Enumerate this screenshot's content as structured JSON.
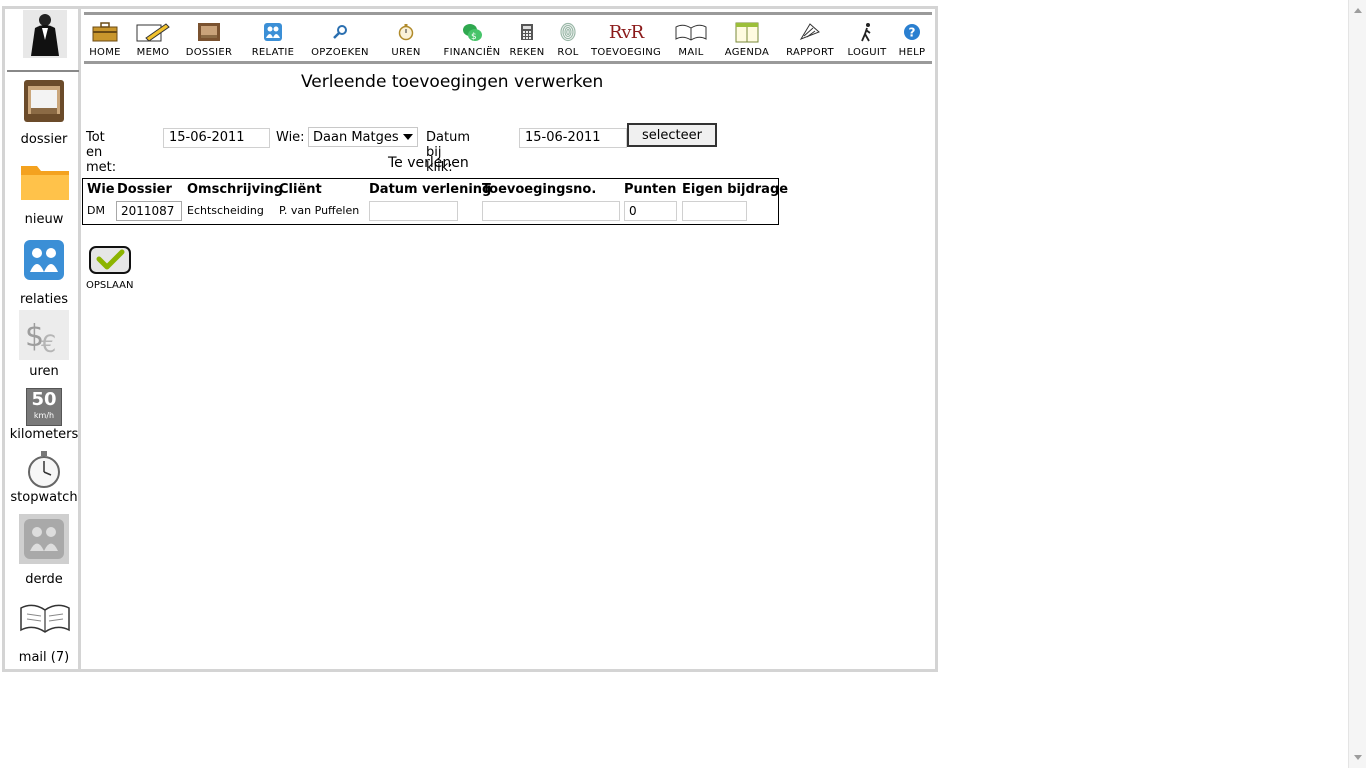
{
  "toolbar": {
    "items": [
      {
        "label": "HOME",
        "icon": "briefcase-icon"
      },
      {
        "label": "MEMO",
        "icon": "pencil-icon"
      },
      {
        "label": "DOSSIER",
        "icon": "dossier-icon"
      },
      {
        "label": "RELATIE",
        "icon": "people-icon"
      },
      {
        "label": "OPZOEKEN",
        "icon": "magnifier-icon"
      },
      {
        "label": "UREN",
        "icon": "stopwatch-icon"
      },
      {
        "label": "FINANCIËN",
        "icon": "money-icon"
      },
      {
        "label": "REKEN",
        "icon": "calculator-icon"
      },
      {
        "label": "ROL",
        "icon": "fingerprint-icon"
      },
      {
        "label": "TOEVOEGING",
        "icon": "rvr-logo-icon"
      },
      {
        "label": "MAIL",
        "icon": "open-book-icon"
      },
      {
        "label": "AGENDA",
        "icon": "calendar-icon"
      },
      {
        "label": "RAPPORT",
        "icon": "report-icon"
      },
      {
        "label": "LOGUIT",
        "icon": "walking-man-icon"
      },
      {
        "label": "HELP",
        "icon": "help-icon"
      }
    ],
    "rvr_text": "RvR"
  },
  "sidebar": {
    "items": [
      {
        "label": "dossier",
        "icon": "cabinet-icon"
      },
      {
        "label": "nieuw",
        "icon": "folder-icon"
      },
      {
        "label": "relaties",
        "icon": "relations-icon"
      },
      {
        "label": "uren",
        "icon": "currency-icon"
      },
      {
        "label": "kilometers",
        "icon": "speed-sign-icon"
      },
      {
        "label": "stopwatch",
        "icon": "stopwatch-icon"
      },
      {
        "label": "derde",
        "icon": "third-party-icon"
      },
      {
        "label": "mail (7)",
        "icon": "open-book-icon"
      }
    ],
    "speed_sign_number": "50",
    "speed_sign_unit": "km/h"
  },
  "page": {
    "title": "Verleende toevoegingen verwerken",
    "subtitle": "Te verlenen"
  },
  "filter": {
    "until_label": "Tot en met:",
    "until_value": "15-06-2011",
    "who_label": "Wie:",
    "who_value": "Daan Matges",
    "date_click_label": "Datum bij klik:",
    "date_click_value": "15-06-2011",
    "select_button": "selecteer"
  },
  "table": {
    "headers": [
      "Wie",
      "Dossier",
      "Omschrijving",
      "Cliënt",
      "Datum verlening",
      "Toevoegingsno.",
      "Punten",
      "Eigen bijdrage"
    ],
    "rows": [
      {
        "who": "DM",
        "dossier": "2011087",
        "description": "Echtscheiding",
        "client": "P. van Puffelen",
        "date_granted": "",
        "assignment_no": "",
        "points": "0",
        "own_contribution": ""
      }
    ]
  },
  "save": {
    "label": "OPSLAAN"
  },
  "colors": {
    "border": "#d4d4d4",
    "toolbar_rule": "#9a9a9a",
    "rvr_red": "#8b1a1a",
    "check_green": "#8cb400"
  }
}
